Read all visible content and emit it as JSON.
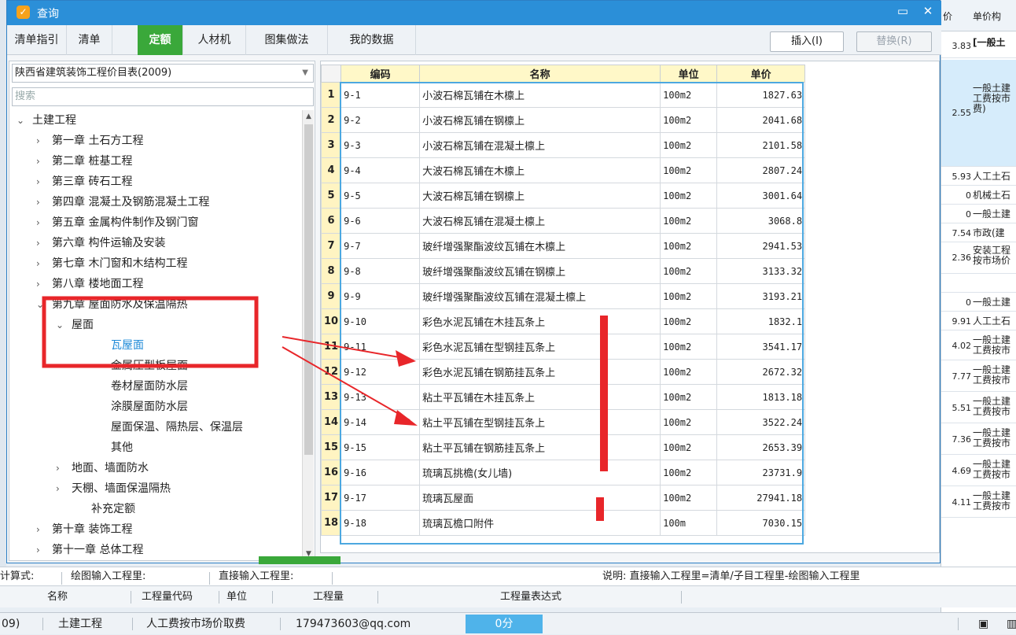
{
  "window": {
    "title": "查询",
    "minimize": "▭",
    "close": "✕"
  },
  "tabs": [
    "清单指引",
    "清单",
    "定额",
    "人材机",
    "图集做法",
    "我的数据"
  ],
  "buttons": {
    "insert": "插入(I)",
    "replace": "替换(R)"
  },
  "library": {
    "selected": "陕西省建筑装饰工程价目表(2009)"
  },
  "search": {
    "placeholder": "搜索"
  },
  "tree": [
    {
      "label": "土建工程",
      "expander": "⌄"
    },
    {
      "label": "第一章 土石方工程",
      "expander": "›"
    },
    {
      "label": "第二章 桩基工程",
      "expander": "›"
    },
    {
      "label": "第三章 砖石工程",
      "expander": "›"
    },
    {
      "label": "第四章 混凝土及钢筋混凝土工程",
      "expander": "›"
    },
    {
      "label": "第五章 金属构件制作及钢门窗",
      "expander": "›"
    },
    {
      "label": "第六章 构件运输及安装",
      "expander": "›"
    },
    {
      "label": "第七章 木门窗和木结构工程",
      "expander": "›"
    },
    {
      "label": "第八章 楼地面工程",
      "expander": "›"
    },
    {
      "label": "第九章 屋面防水及保温隔热",
      "expander": "⌄"
    },
    {
      "label": "屋面",
      "expander": "⌄"
    },
    {
      "label": "瓦屋面",
      "expander": ""
    },
    {
      "label": "金属压型板屋面",
      "expander": ""
    },
    {
      "label": "卷材屋面防水层",
      "expander": ""
    },
    {
      "label": "涂膜屋面防水层",
      "expander": ""
    },
    {
      "label": "屋面保温、隔热层、保温层",
      "expander": ""
    },
    {
      "label": "其他",
      "expander": ""
    },
    {
      "label": "地面、墙面防水",
      "expander": "›"
    },
    {
      "label": "天棚、墙面保温隔热",
      "expander": "›"
    },
    {
      "label": "补充定额",
      "expander": ""
    },
    {
      "label": "第十章 装饰工程",
      "expander": "›"
    },
    {
      "label": "第十一章 总体工程",
      "expander": "›"
    }
  ],
  "grid": {
    "headers": [
      "编码",
      "名称",
      "单位",
      "单价"
    ],
    "rows": [
      {
        "n": "1",
        "code": "9-1",
        "name": "小波石棉瓦铺在木檩上",
        "unit": "100m2",
        "price": "1827.63"
      },
      {
        "n": "2",
        "code": "9-2",
        "name": "小波石棉瓦铺在钢檩上",
        "unit": "100m2",
        "price": "2041.68"
      },
      {
        "n": "3",
        "code": "9-3",
        "name": "小波石棉瓦铺在混凝土檩上",
        "unit": "100m2",
        "price": "2101.58"
      },
      {
        "n": "4",
        "code": "9-4",
        "name": "大波石棉瓦铺在木檩上",
        "unit": "100m2",
        "price": "2807.24"
      },
      {
        "n": "5",
        "code": "9-5",
        "name": "大波石棉瓦铺在钢檩上",
        "unit": "100m2",
        "price": "3001.64"
      },
      {
        "n": "6",
        "code": "9-6",
        "name": "大波石棉瓦铺在混凝土檩上",
        "unit": "100m2",
        "price": "3068.8"
      },
      {
        "n": "7",
        "code": "9-7",
        "name": "玻纤增强聚酯波纹瓦铺在木檩上",
        "unit": "100m2",
        "price": "2941.53"
      },
      {
        "n": "8",
        "code": "9-8",
        "name": "玻纤增强聚酯波纹瓦铺在钢檩上",
        "unit": "100m2",
        "price": "3133.32"
      },
      {
        "n": "9",
        "code": "9-9",
        "name": "玻纤增强聚酯波纹瓦铺在混凝土檩上",
        "unit": "100m2",
        "price": "3193.21"
      },
      {
        "n": "10",
        "code": "9-10",
        "name": "彩色水泥瓦铺在木挂瓦条上",
        "unit": "100m2",
        "price": "1832.1"
      },
      {
        "n": "11",
        "code": "9-11",
        "name": "彩色水泥瓦铺在型钢挂瓦条上",
        "unit": "100m2",
        "price": "3541.17"
      },
      {
        "n": "12",
        "code": "9-12",
        "name": "彩色水泥瓦铺在钢筋挂瓦条上",
        "unit": "100m2",
        "price": "2672.32"
      },
      {
        "n": "13",
        "code": "9-13",
        "name": "粘土平瓦铺在木挂瓦条上",
        "unit": "100m2",
        "price": "1813.18"
      },
      {
        "n": "14",
        "code": "9-14",
        "name": "粘土平瓦铺在型钢挂瓦条上",
        "unit": "100m2",
        "price": "3522.24"
      },
      {
        "n": "15",
        "code": "9-15",
        "name": "粘土平瓦铺在钢筋挂瓦条上",
        "unit": "100m2",
        "price": "2653.39"
      },
      {
        "n": "16",
        "code": "9-16",
        "name": "琉璃瓦挑檐(女儿墙)",
        "unit": "100m2",
        "price": "23731.9"
      },
      {
        "n": "17",
        "code": "9-17",
        "name": "琉璃瓦屋面",
        "unit": "100m2",
        "price": "27941.18"
      },
      {
        "n": "18",
        "code": "9-18",
        "name": "琉璃瓦檐口附件",
        "unit": "100m",
        "price": "7030.15"
      }
    ]
  },
  "calc": {
    "prefix": "计算式:",
    "drawing": "绘图输入工程里:",
    "direct": "直接输入工程里:",
    "note": "说明: 直接输入工程里=清单/子目工程里-绘图输入工程里"
  },
  "calc_headers": [
    "名称",
    "工程量代码",
    "单位",
    "工程量",
    "工程量表达式"
  ],
  "status": {
    "year": "09)",
    "profession": "土建工程",
    "fee": "人工费按市场价取费",
    "email": "179473603@qq.com",
    "timer": "0分"
  },
  "background": {
    "header": [
      "价",
      "单价构"
    ],
    "rows": [
      {
        "num": "3.83",
        "txt": "[一般土"
      },
      {
        "num": "2.55",
        "txt": "一般土建\n工费按市\n费)"
      },
      {
        "num": "5.93",
        "txt": "人工土石"
      },
      {
        "num": "0",
        "txt": "机械土石"
      },
      {
        "num": "0",
        "txt": "一般土建"
      },
      {
        "num": "7.54",
        "txt": "市政(建"
      },
      {
        "num": "2.36",
        "txt": "安装工程\n按市场价"
      },
      {
        "num": "",
        "txt": ""
      },
      {
        "num": "0",
        "txt": "一般土建"
      },
      {
        "num": "9.91",
        "txt": "人工土石"
      },
      {
        "num": "4.02",
        "txt": "一般土建\n工费按市"
      },
      {
        "num": "7.77",
        "txt": "一般土建\n工费按市"
      },
      {
        "num": "5.51",
        "txt": "一般土建\n工费按市"
      },
      {
        "num": "7.36",
        "txt": "一般土建\n工费按市"
      },
      {
        "num": "4.69",
        "txt": "一般土建\n工费按市"
      },
      {
        "num": "4.11",
        "txt": "一般土建\n工费按市"
      }
    ]
  },
  "colors": {
    "titlebar": "#2b8fd8",
    "active_tab": "#3aa83a",
    "annotation": "#e8262a",
    "selected_tree": "#1f8ad8"
  }
}
